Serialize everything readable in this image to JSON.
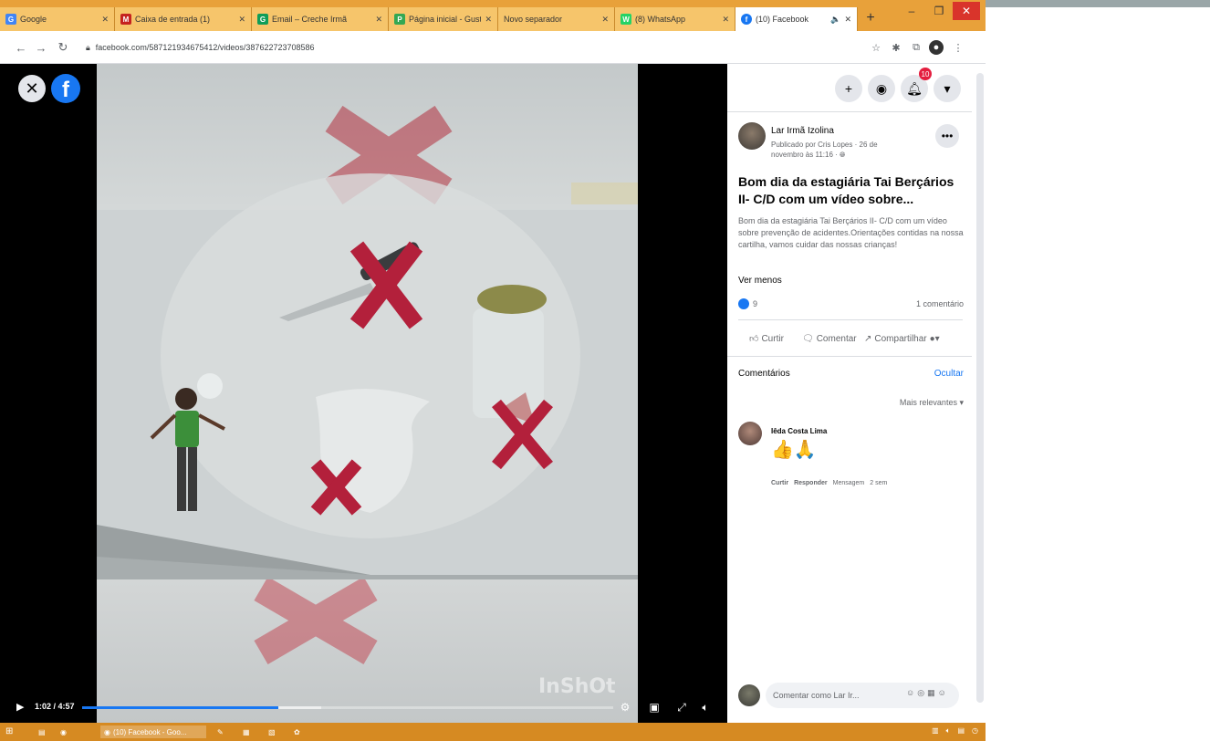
{
  "browser": {
    "tabs": [
      {
        "title": "Google",
        "favicon_color": "#4285f4",
        "favicon": "G"
      },
      {
        "title": "Caixa de entrada (1)",
        "favicon_color": "#c5221f",
        "favicon": "M"
      },
      {
        "title": "Email – Creche Irmã",
        "favicon_color": "#0f9d58",
        "favicon": "G"
      },
      {
        "title": "Página inicial - Gust",
        "favicon_color": "#34a853",
        "favicon": "P"
      },
      {
        "title": "Novo separador",
        "favicon_color": "#9aa0a6",
        "favicon": ""
      },
      {
        "title": "(8) WhatsApp",
        "favicon_color": "#25d366",
        "favicon": "W"
      },
      {
        "title": "(10) Facebook",
        "favicon_color": "#1877f2",
        "favicon": "f"
      }
    ],
    "address": "facebook.com/587121934675412/videos/387622723708586"
  },
  "video": {
    "time": "1:02 / 4:57",
    "progress": 0.37,
    "buffered": 0.45,
    "watermark": "InShOt"
  },
  "panel": {
    "notification_count": "10",
    "page_name": "Lar Irmã Izolina",
    "posted_by": "Publicado por Cris Lopes · 26 de novembro às 11:16 · ",
    "post_title": "Bom dia da estagiária Tai Berçários II- C/D com um vídeo sobre...",
    "post_body": "Bom dia da estagiária Tai Berçários II- C/D com um vídeo sobre prevenção de acidentes.Orientações contidas na nossa cartilha, vamos cuidar das nossas crianças!",
    "see_less": "Ver menos",
    "reaction_count": "9",
    "comment_count": "1 comentário",
    "actions": {
      "like": "Curtir",
      "comment": "Comentar",
      "share": "Compartilhar"
    },
    "comments_label": "Comentários",
    "hide_label": "Ocultar",
    "sort_label": "Mais relevantes",
    "comment": {
      "author": "Iêda Costa Lima",
      "text": "👍🙏",
      "like": "Curtir",
      "reply": "Responder",
      "message": "Mensagem",
      "time": "2 sem"
    },
    "comment_placeholder": "Comentar como Lar Ir..."
  },
  "taskbar": {
    "active_item": "(10) Facebook - Goo..."
  },
  "colors": {
    "fb_blue": "#1877f2",
    "tabbar": "#e8a13a",
    "taskbar": "#d68a22"
  }
}
